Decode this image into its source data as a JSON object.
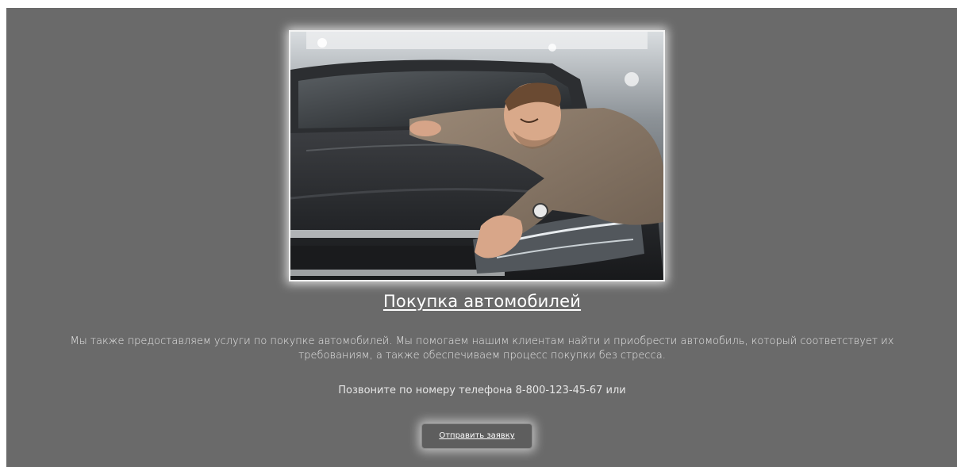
{
  "hero_image": {
    "subject": "man-hugging-car-icon"
  },
  "section": {
    "title": "Покупка автомобилей",
    "description": "Мы также предоставляем услуги по покупке автомобилей. Мы помогаем нашим клиентам найти и приобрести автомобиль, который соответствует их требованиям, а также обеспечиваем процесс покупки без стресса.",
    "phone_text": "Позвоните по номеру телефона 8-800-123-45-67 или",
    "button_label": "Отправить заявку"
  },
  "colors": {
    "panel_bg": "#6a6a6a",
    "text": "#ffffff",
    "glow": "#ffffff"
  }
}
